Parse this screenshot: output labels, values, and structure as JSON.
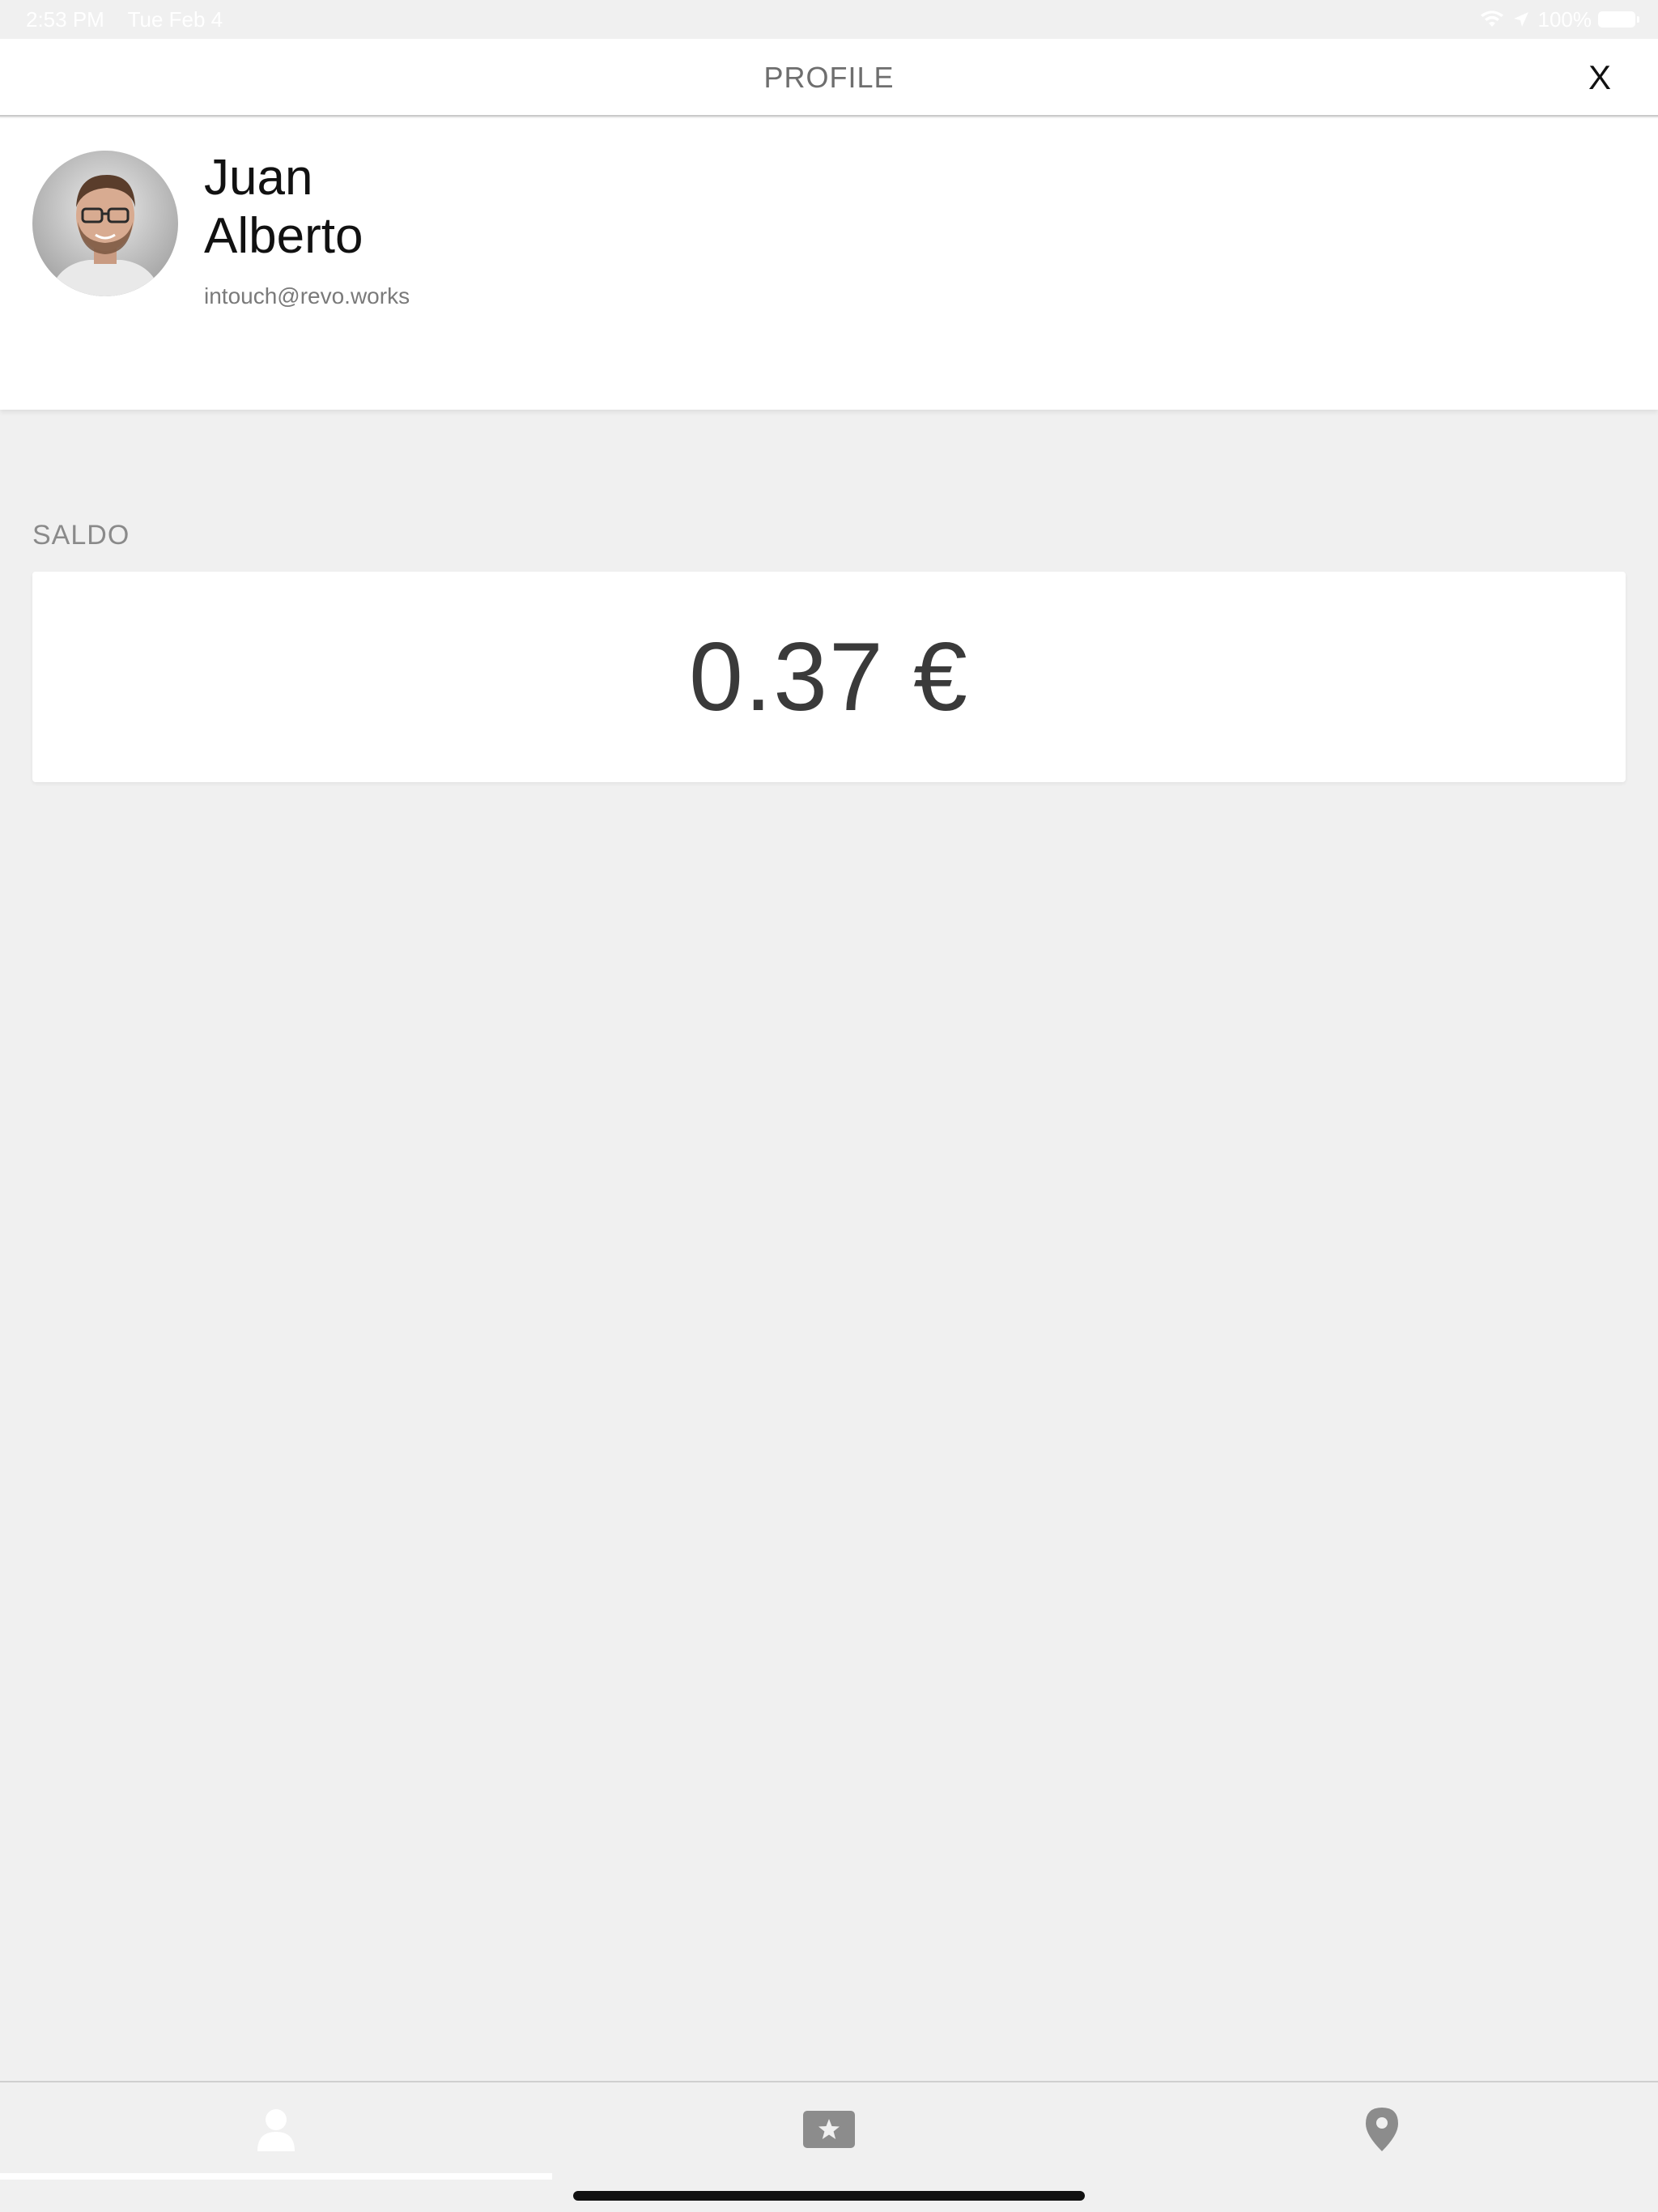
{
  "status_bar": {
    "time": "2:53 PM",
    "date": "Tue Feb 4",
    "battery": "100%",
    "icons": [
      "wifi-icon",
      "location-arrow-icon",
      "battery-icon"
    ]
  },
  "header": {
    "title": "PROFILE",
    "close_label": "X"
  },
  "profile": {
    "first_name": "Juan",
    "last_name": "Alberto",
    "email": "intouch@revo.works"
  },
  "balance": {
    "label": "SALDO",
    "value": "0.37 €"
  },
  "tab_bar": {
    "tabs": [
      {
        "name": "profile",
        "icon": "person-icon",
        "active": true
      },
      {
        "name": "favorites",
        "icon": "star-card-icon",
        "active": false
      },
      {
        "name": "location",
        "icon": "map-pin-icon",
        "active": false
      }
    ]
  },
  "colors": {
    "background": "#f0f0f0",
    "card": "#ffffff",
    "text_primary": "#111111",
    "text_muted": "#7a7a7a",
    "icon_gray": "#8c8c8c",
    "tab_indicator": "#ffffff"
  }
}
